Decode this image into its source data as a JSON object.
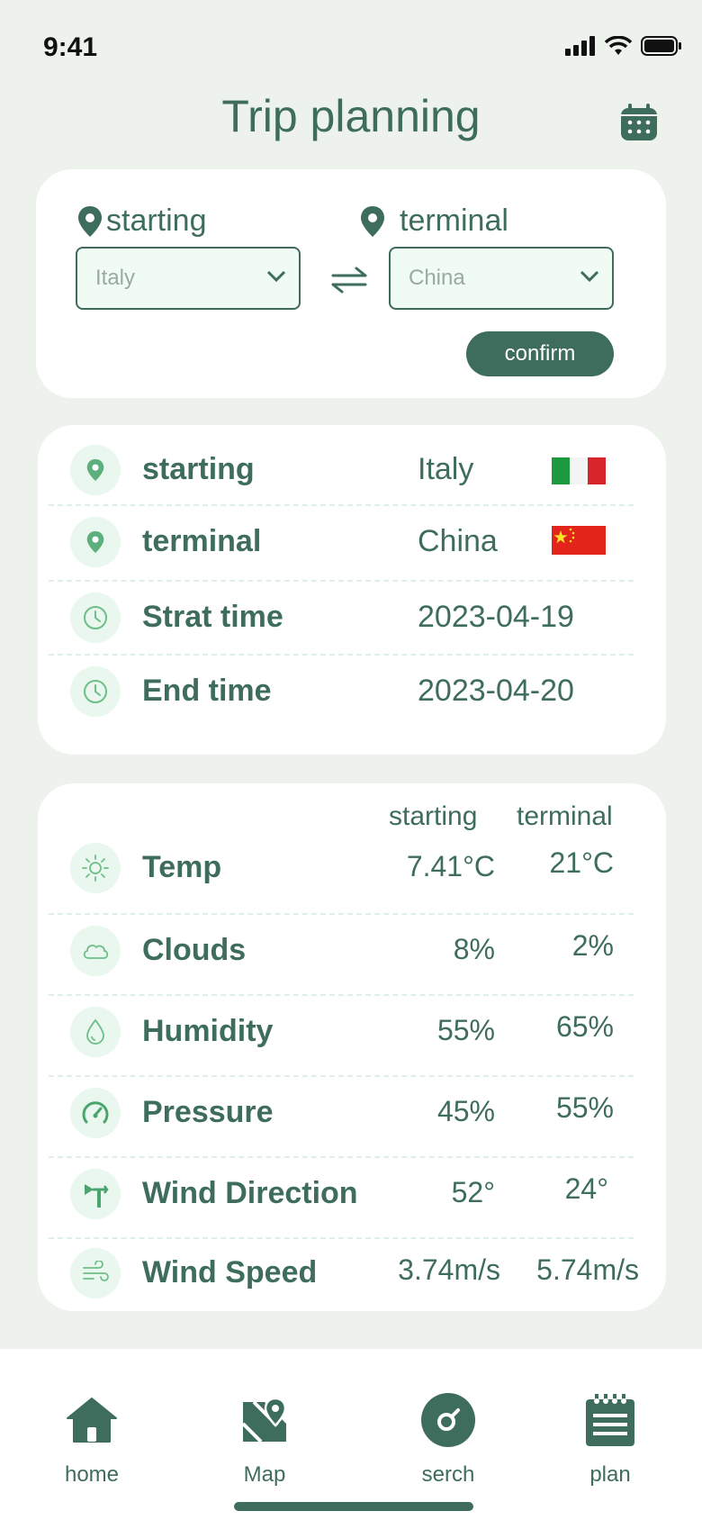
{
  "status": {
    "time": "9:41"
  },
  "header": {
    "title": "Trip planning"
  },
  "route_form": {
    "starting_label": "starting",
    "terminal_label": "terminal",
    "starting_value": "Italy",
    "terminal_value": "China",
    "confirm_label": "confirm"
  },
  "trip": {
    "rows": [
      {
        "label": "starting",
        "value": "Italy",
        "flag": "italy"
      },
      {
        "label": "terminal",
        "value": "China",
        "flag": "china"
      },
      {
        "label": "Strat time",
        "value": "2023-04-19"
      },
      {
        "label": "End time",
        "value": "2023-04-20"
      }
    ]
  },
  "weather": {
    "col_starting": "starting",
    "col_terminal": "terminal",
    "rows": [
      {
        "label": "Temp",
        "icon": "sun-icon",
        "start": "7.41°C",
        "end": "21°C"
      },
      {
        "label": "Clouds",
        "icon": "cloud-icon",
        "start": "8%",
        "end": "2%"
      },
      {
        "label": "Humidity",
        "icon": "drop-icon",
        "start": "55%",
        "end": "65%"
      },
      {
        "label": "Pressure",
        "icon": "gauge-icon",
        "start": "45%",
        "end": "55%"
      },
      {
        "label": "Wind Direction",
        "icon": "wind-vane-icon",
        "start": "52°",
        "end": "24°"
      },
      {
        "label": "Wind Speed",
        "icon": "wind-icon",
        "start": "3.74m/s",
        "end": "5.74m/s"
      }
    ]
  },
  "tabs": [
    {
      "label": "home",
      "icon": "home-icon"
    },
    {
      "label": "Map",
      "icon": "map-icon"
    },
    {
      "label": "serch",
      "icon": "search-icon"
    },
    {
      "label": "plan",
      "icon": "notepad-icon"
    }
  ],
  "colors": {
    "accent": "#3e6d5d",
    "background": "#edf2ec",
    "icon_green": "#5db07d"
  }
}
